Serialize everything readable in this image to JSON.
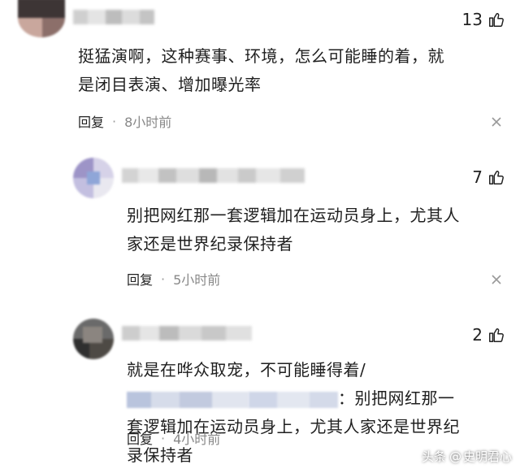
{
  "comments": [
    {
      "likes": "13",
      "text": "挺猛演啊，这种赛事、环境，怎么可能睡的着，就是闭目表演、增加曝光率",
      "reply_label": "回复",
      "dot": "·",
      "time": "8小时前"
    },
    {
      "likes": "7",
      "text": "别把网红那一套逻辑加在运动员身上，尤其人家还是世界纪录保持者",
      "reply_label": "回复",
      "dot": "·",
      "time": "5小时前"
    },
    {
      "likes": "2",
      "text_before_mention": "就是在哗众取宠，不可能睡得着/",
      "text_after_mention": "：别把网红那一套逻辑加在运动员身上，尤其人家还是世界纪录保持者",
      "reply_label": "回复",
      "dot": "·",
      "time": "4小时前"
    }
  ],
  "watermark": {
    "prefix": "头条",
    "at": "@",
    "name": "史明君心"
  },
  "colors": {
    "text": "#1f1f1f",
    "meta_gray": "#888888",
    "background": "#ffffff"
  },
  "icons": [
    "thumbs-up-icon",
    "close-icon"
  ]
}
